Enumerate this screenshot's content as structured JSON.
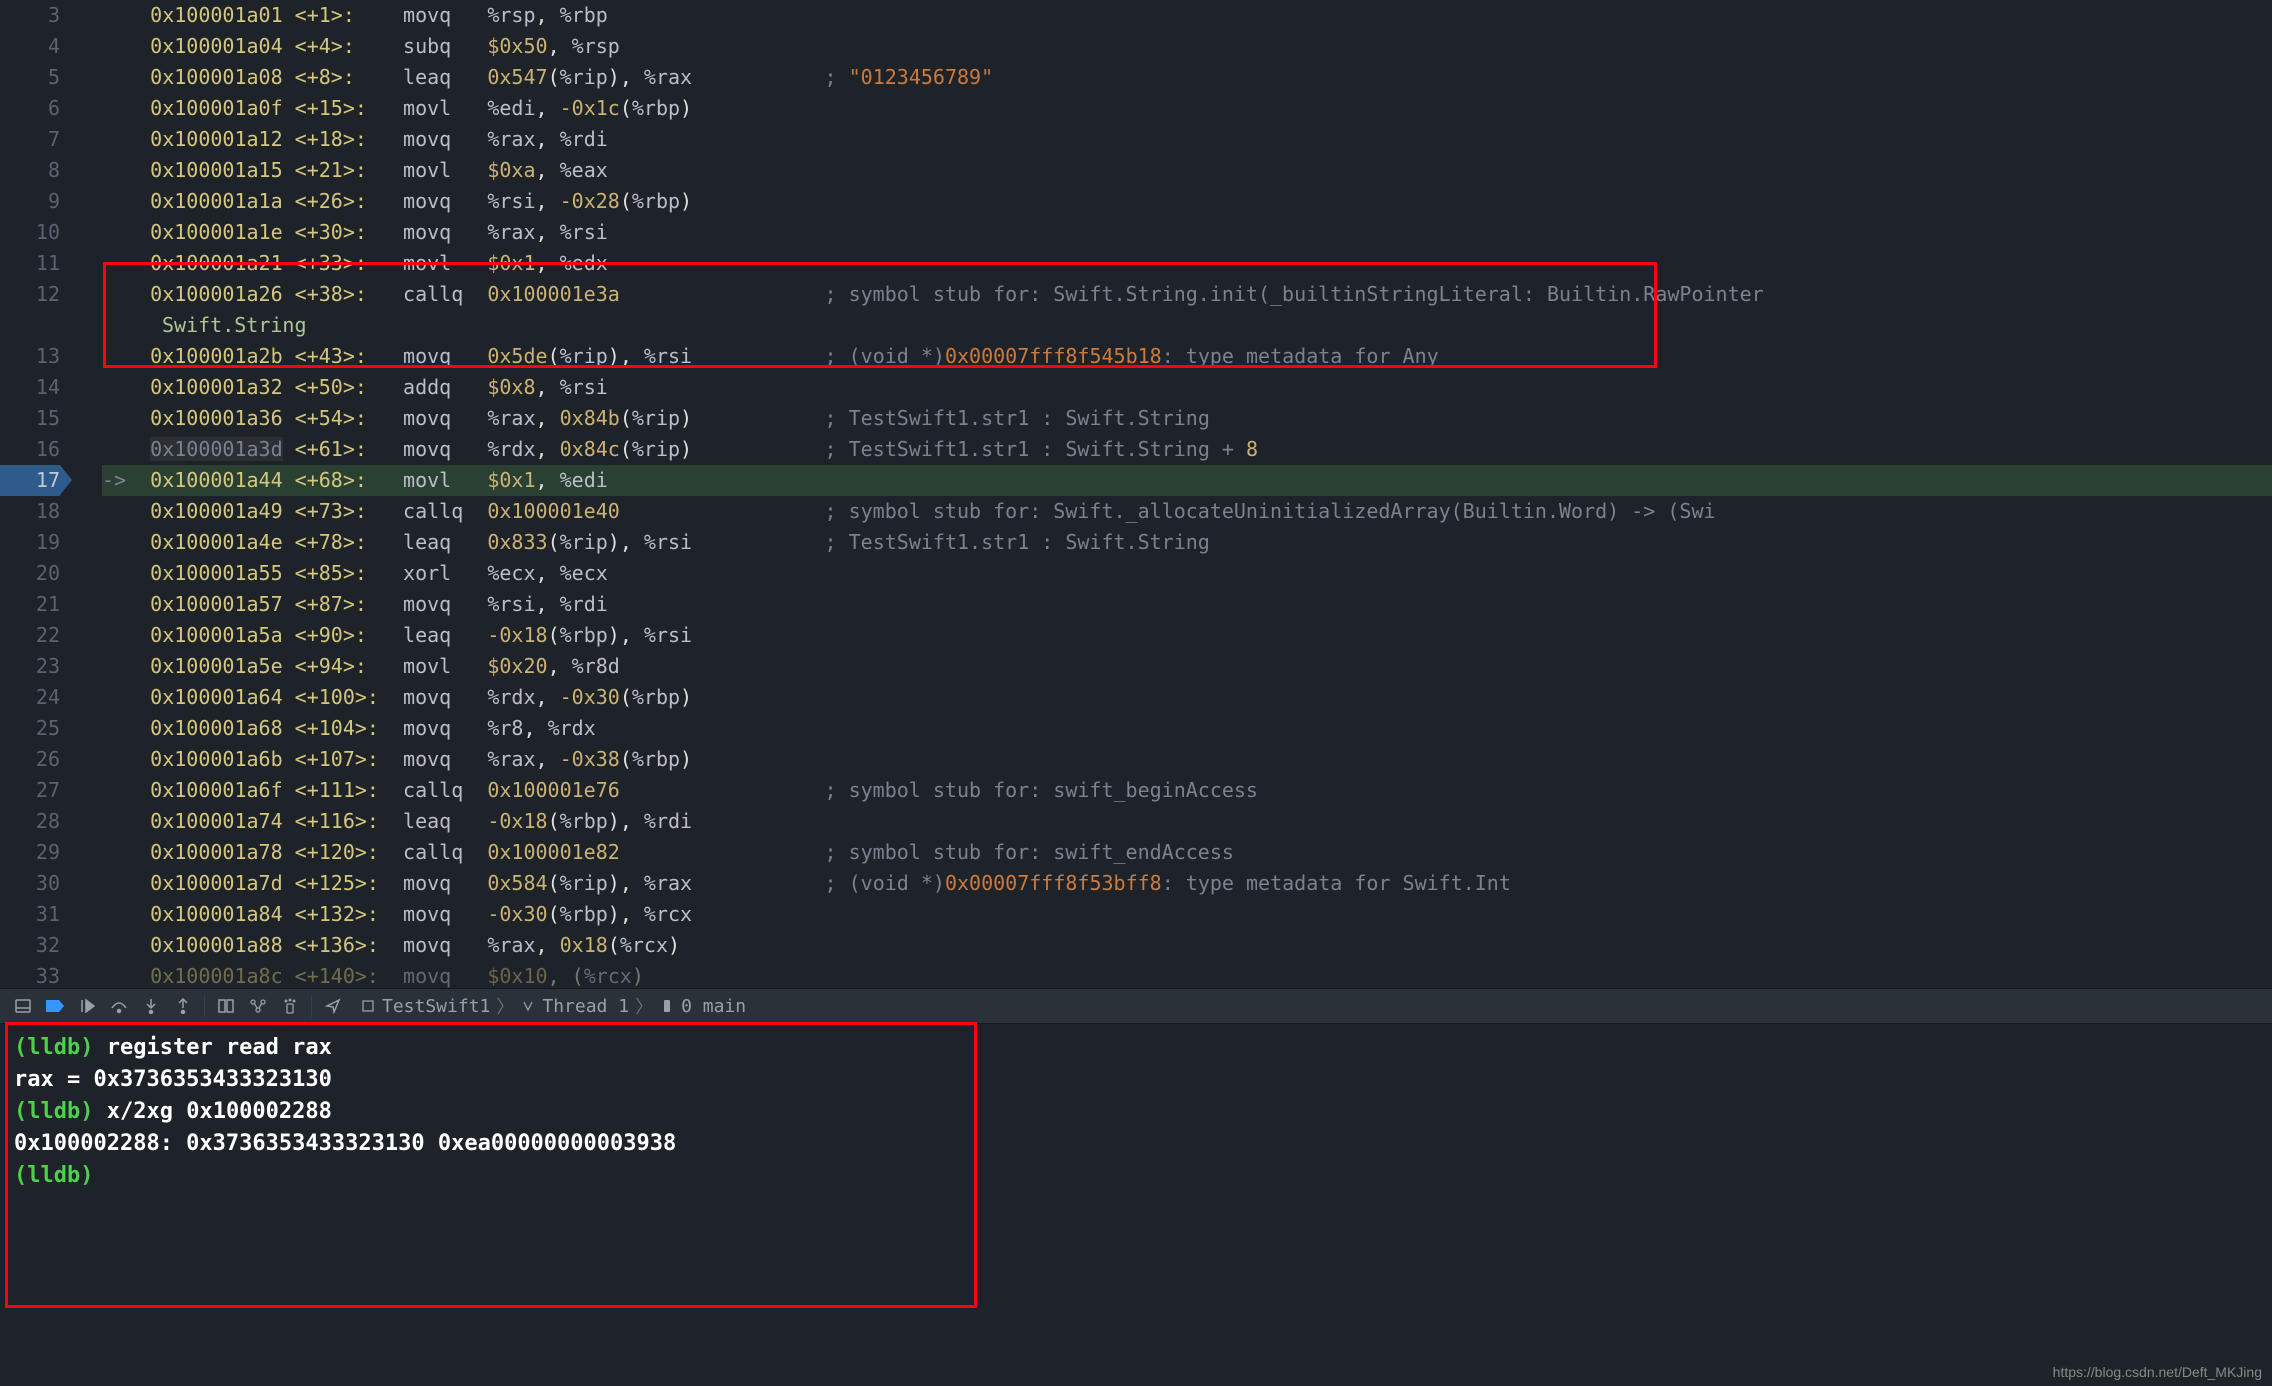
{
  "gutter_start": 3,
  "gutter_end": 33,
  "current_line": 17,
  "lines": [
    {
      "addr": "0x100001a01",
      "off": "<+1>:",
      "instr": "movq",
      "ops": "%rsp, %rbp",
      "comment": ""
    },
    {
      "addr": "0x100001a04",
      "off": "<+4>:",
      "instr": "subq",
      "ops": "$0x50, %rsp",
      "comment": ""
    },
    {
      "addr": "0x100001a08",
      "off": "<+8>:",
      "instr": "leaq",
      "ops": "0x547(%rip), %rax",
      "comment": "; ",
      "str": "\"0123456789\""
    },
    {
      "addr": "0x100001a0f",
      "off": "<+15>:",
      "instr": "movl",
      "ops": "%edi, -0x1c(%rbp)",
      "comment": ""
    },
    {
      "addr": "0x100001a12",
      "off": "<+18>:",
      "instr": "movq",
      "ops": "%rax, %rdi",
      "comment": ""
    },
    {
      "addr": "0x100001a15",
      "off": "<+21>:",
      "instr": "movl",
      "ops": "$0xa, %eax",
      "comment": ""
    },
    {
      "addr": "0x100001a1a",
      "off": "<+26>:",
      "instr": "movq",
      "ops": "%rsi, -0x28(%rbp)",
      "comment": ""
    },
    {
      "addr": "0x100001a1e",
      "off": "<+30>:",
      "instr": "movq",
      "ops": "%rax, %rsi",
      "comment": ""
    },
    {
      "addr": "0x100001a21",
      "off": "<+33>:",
      "instr": "movl",
      "ops": "$0x1, %edx",
      "comment": ""
    },
    {
      "addr": "0x100001a26",
      "off": "<+38>:",
      "instr": "callq",
      "ops": "0x100001e3a",
      "comment": "; symbol stub for: Swift.String.init(_builtinStringLiteral: Builtin.RawPointer"
    },
    {
      "indent": "Swift.String"
    },
    {
      "addr": "0x100001a2b",
      "off": "<+43>:",
      "instr": "movq",
      "ops": "0x5de(%rip), %rsi",
      "comment": "; (void *)",
      "ptr": "0x00007fff8f545b18",
      "comment2": ": type metadata for Any"
    },
    {
      "addr": "0x100001a32",
      "off": "<+50>:",
      "instr": "addq",
      "ops": "$0x8, %rsi",
      "comment": "",
      "box": true
    },
    {
      "addr": "0x100001a36",
      "off": "<+54>:",
      "instr": "movq",
      "ops": "%rax, 0x84b(%rip)",
      "comment": "; TestSwift1.str1 : Swift.String",
      "box": true
    },
    {
      "addr": "0x100001a3d",
      "off": "<+61>:",
      "instr": "movq",
      "ops": "%rdx, 0x84c(%rip)",
      "comment": "; TestSwift1.str1 : Swift.String + ",
      "plus": "8",
      "box": true,
      "grey": true
    },
    {
      "addr": "0x100001a44",
      "off": "<+68>:",
      "instr": "movl",
      "ops": "$0x1, %edi",
      "comment": "",
      "current": true,
      "arrow": true
    },
    {
      "addr": "0x100001a49",
      "off": "<+73>:",
      "instr": "callq",
      "ops": "0x100001e40",
      "comment": "; symbol stub for: Swift._allocateUninitializedArray<A>(Builtin.Word) -> (Swi"
    },
    {
      "addr": "0x100001a4e",
      "off": "<+78>:",
      "instr": "leaq",
      "ops": "0x833(%rip), %rsi",
      "comment": "; TestSwift1.str1 : Swift.String"
    },
    {
      "addr": "0x100001a55",
      "off": "<+85>:",
      "instr": "xorl",
      "ops": "%ecx, %ecx",
      "comment": ""
    },
    {
      "addr": "0x100001a57",
      "off": "<+87>:",
      "instr": "movq",
      "ops": "%rsi, %rdi",
      "comment": ""
    },
    {
      "addr": "0x100001a5a",
      "off": "<+90>:",
      "instr": "leaq",
      "ops": "-0x18(%rbp), %rsi",
      "comment": ""
    },
    {
      "addr": "0x100001a5e",
      "off": "<+94>:",
      "instr": "movl",
      "ops": "$0x20, %r8d",
      "comment": ""
    },
    {
      "addr": "0x100001a64",
      "off": "<+100>:",
      "instr": "movq",
      "ops": "%rdx, -0x30(%rbp)",
      "comment": ""
    },
    {
      "addr": "0x100001a68",
      "off": "<+104>:",
      "instr": "movq",
      "ops": "%r8, %rdx",
      "comment": ""
    },
    {
      "addr": "0x100001a6b",
      "off": "<+107>:",
      "instr": "movq",
      "ops": "%rax, -0x38(%rbp)",
      "comment": ""
    },
    {
      "addr": "0x100001a6f",
      "off": "<+111>:",
      "instr": "callq",
      "ops": "0x100001e76",
      "comment": "; symbol stub for: swift_beginAccess"
    },
    {
      "addr": "0x100001a74",
      "off": "<+116>:",
      "instr": "leaq",
      "ops": "-0x18(%rbp), %rdi",
      "comment": ""
    },
    {
      "addr": "0x100001a78",
      "off": "<+120>:",
      "instr": "callq",
      "ops": "0x100001e82",
      "comment": "; symbol stub for: swift_endAccess"
    },
    {
      "addr": "0x100001a7d",
      "off": "<+125>:",
      "instr": "movq",
      "ops": "0x584(%rip), %rax",
      "comment": "; (void *)",
      "ptr": "0x00007fff8f53bff8",
      "comment2": ": type metadata for Swift.Int"
    },
    {
      "addr": "0x100001a84",
      "off": "<+132>:",
      "instr": "movq",
      "ops": "-0x30(%rbp), %rcx",
      "comment": ""
    },
    {
      "addr": "0x100001a88",
      "off": "<+136>:",
      "instr": "movq",
      "ops": "%rax, 0x18(%rcx)",
      "comment": ""
    },
    {
      "addr": "0x100001a8c",
      "off": "<+140>:",
      "instr": "movq",
      "ops": "$0x10, (%rcx)",
      "comment": "",
      "faded": true
    }
  ],
  "breadcrumb": {
    "item1": "TestSwift1",
    "item2": "Thread 1",
    "item3": "0 main"
  },
  "console": {
    "prompt": "(lldb)",
    "cmd1": "register read rax",
    "out1": "     rax = 0x3736353433323130",
    "cmd2": "x/2xg 0x100002288",
    "out2": "0x100002288: 0x3736353433323130 0xea00000000003938"
  },
  "watermark": "https://blog.csdn.net/Deft_MKJing"
}
